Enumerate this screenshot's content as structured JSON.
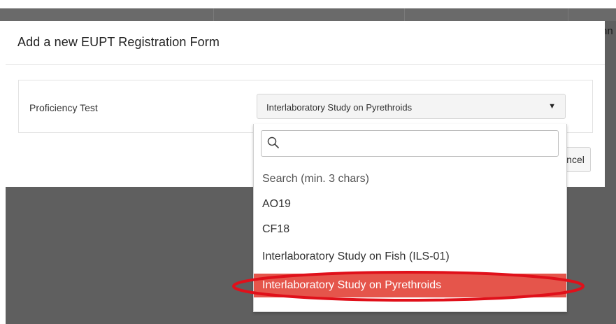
{
  "background": {
    "partial_text": "nn"
  },
  "modal": {
    "title": "Add a new EUPT Registration Form",
    "field_label": "Proficiency Test",
    "select_value": "Interlaboratory Study on Pyrethroids",
    "cancel_label": "ncel"
  },
  "dropdown": {
    "search_placeholder": "",
    "hint": "Search (min. 3 chars)",
    "options": [
      {
        "label": "AO19"
      },
      {
        "label": "CF18"
      },
      {
        "label": "Interlaboratory Study on Fish (ILS-01)"
      },
      {
        "label": "Interlaboratory Study on Pyrethroids",
        "selected": true
      }
    ]
  },
  "colors": {
    "selected_bg": "#e5554b",
    "annotation_ring": "#e0101a"
  }
}
